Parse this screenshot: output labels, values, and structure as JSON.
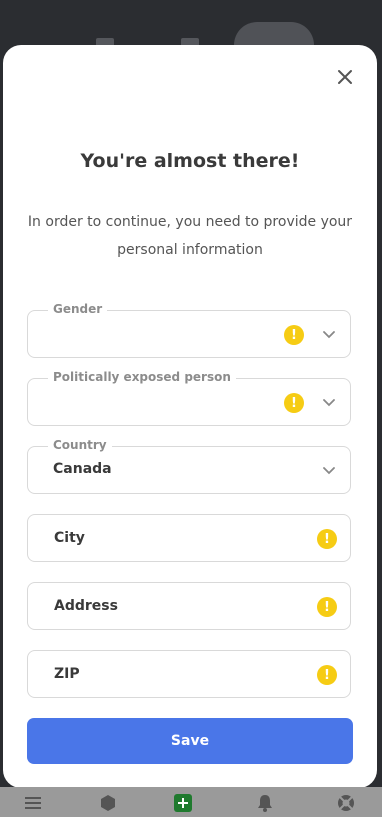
{
  "modal": {
    "title": "You're almost there!",
    "subtitle": "In order to continue, you need to provide your personal information",
    "close_icon": "close-icon"
  },
  "form": {
    "gender": {
      "label": "Gender",
      "value": "",
      "status": "warning"
    },
    "pep": {
      "label": "Politically exposed person",
      "value": "",
      "status": "warning"
    },
    "country": {
      "label": "Country",
      "value": "Canada"
    },
    "city": {
      "placeholder": "City",
      "status": "warning"
    },
    "address": {
      "placeholder": "Address",
      "status": "warning"
    },
    "zip": {
      "placeholder": "ZIP",
      "status": "warning"
    },
    "warning_glyph": "!",
    "save_label": "Save"
  },
  "colors": {
    "accent": "#4a76e8",
    "warning": "#f6cc14",
    "active_nav": "#1f7a2e"
  },
  "bottom_nav": [
    "menu-icon",
    "cube-icon",
    "add-icon",
    "bell-icon",
    "lifebuoy-icon"
  ]
}
